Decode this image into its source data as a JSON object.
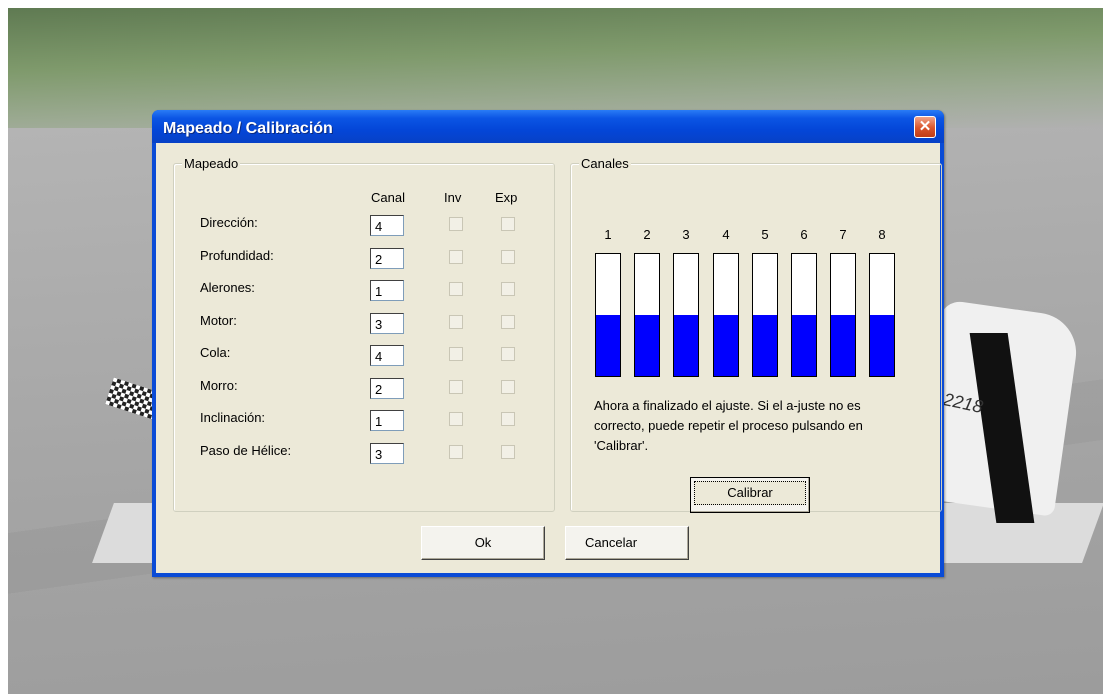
{
  "dialog": {
    "title": "Mapeado / Calibración",
    "close_label": "✕",
    "accent_color": "#0a4bd6"
  },
  "mapping": {
    "group_label": "Mapeado",
    "column_headers": {
      "canal": "Canal",
      "inv": "Inv",
      "exp": "Exp"
    },
    "rows": [
      {
        "label": "Dirección:",
        "channel": "4",
        "inv": false,
        "exp": false
      },
      {
        "label": "Profundidad:",
        "channel": "2",
        "inv": false,
        "exp": false
      },
      {
        "label": "Alerones:",
        "channel": "1",
        "inv": false,
        "exp": false
      },
      {
        "label": "Motor:",
        "channel": "3",
        "inv": false,
        "exp": false
      },
      {
        "label": "Cola:",
        "channel": "4",
        "inv": false,
        "exp": false
      },
      {
        "label": "Morro:",
        "channel": "2",
        "inv": false,
        "exp": false
      },
      {
        "label": "Inclinación:",
        "channel": "1",
        "inv": false,
        "exp": false
      },
      {
        "label": "Paso de Hélice:",
        "channel": "3",
        "inv": false,
        "exp": false
      }
    ]
  },
  "channels": {
    "group_label": "Canales",
    "bar_color": "#0000ff",
    "items": [
      {
        "number": "1",
        "level": 0.5
      },
      {
        "number": "2",
        "level": 0.5
      },
      {
        "number": "3",
        "level": 0.5
      },
      {
        "number": "4",
        "level": 0.5
      },
      {
        "number": "5",
        "level": 0.5
      },
      {
        "number": "6",
        "level": 0.5
      },
      {
        "number": "7",
        "level": 0.5
      },
      {
        "number": "8",
        "level": 0.5
      }
    ],
    "status_text": "Ahora a finalizado el ajuste. Si el a-juste no es correcto, puede repetir el proceso pulsando en 'Calibrar'.",
    "calibrate_label": "Calibrar"
  },
  "buttons": {
    "ok_label": "Ok",
    "cancel_label": "Cancelar"
  },
  "scene": {
    "plane_number": "2218"
  }
}
